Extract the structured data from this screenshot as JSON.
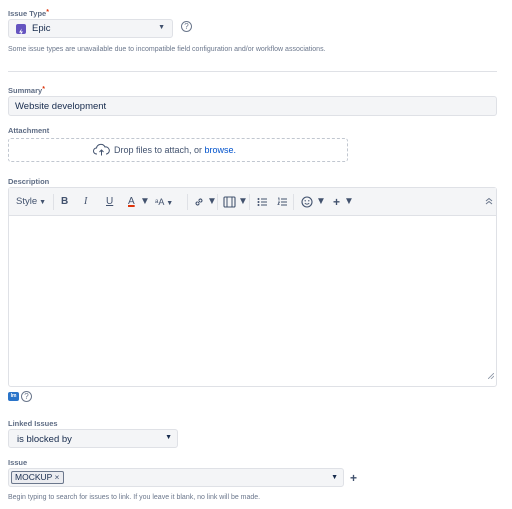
{
  "issue_type": {
    "label": "Issue Type",
    "required_mark": "*",
    "value": "Epic",
    "help_icon": "question-circle-icon",
    "note": "Some issue types are unavailable due to incompatible field configuration and/or workflow associations."
  },
  "summary": {
    "label": "Summary",
    "required_mark": "*",
    "value": "Website development"
  },
  "attachment": {
    "label": "Attachment",
    "drop_text": "Drop files to attach, or ",
    "browse_link": "browse."
  },
  "description": {
    "label": "Description",
    "toolbar": {
      "style": "Style",
      "bold": "B",
      "italic": "I",
      "underline": "U",
      "text_color": "A",
      "more_format": "ᵃA",
      "link_icon": "link-icon",
      "attachment_icon": "media-icon",
      "bullet_list_icon": "bullet-list-icon",
      "number_list_icon": "numbered-list-icon",
      "emoji_icon": "emoji-icon",
      "insert_icon": "plus-icon",
      "collapse_icon": "chevron-up-icon"
    },
    "text_color_accent": "#de350b"
  },
  "editor_footer": {
    "mode_badge": "Im",
    "help_icon": "question-circle-icon"
  },
  "linked_issues": {
    "label": "Linked Issues",
    "value": "is blocked by"
  },
  "issue": {
    "label": "Issue",
    "tag": "MOCKUP",
    "tag_remove": "×",
    "add_icon": "plus-icon",
    "note": "Begin typing to search for issues to link. If you leave it blank, no link will be made."
  },
  "colors": {
    "epic": "#6554c0",
    "link": "#0052cc",
    "label": "#5e6c84"
  }
}
